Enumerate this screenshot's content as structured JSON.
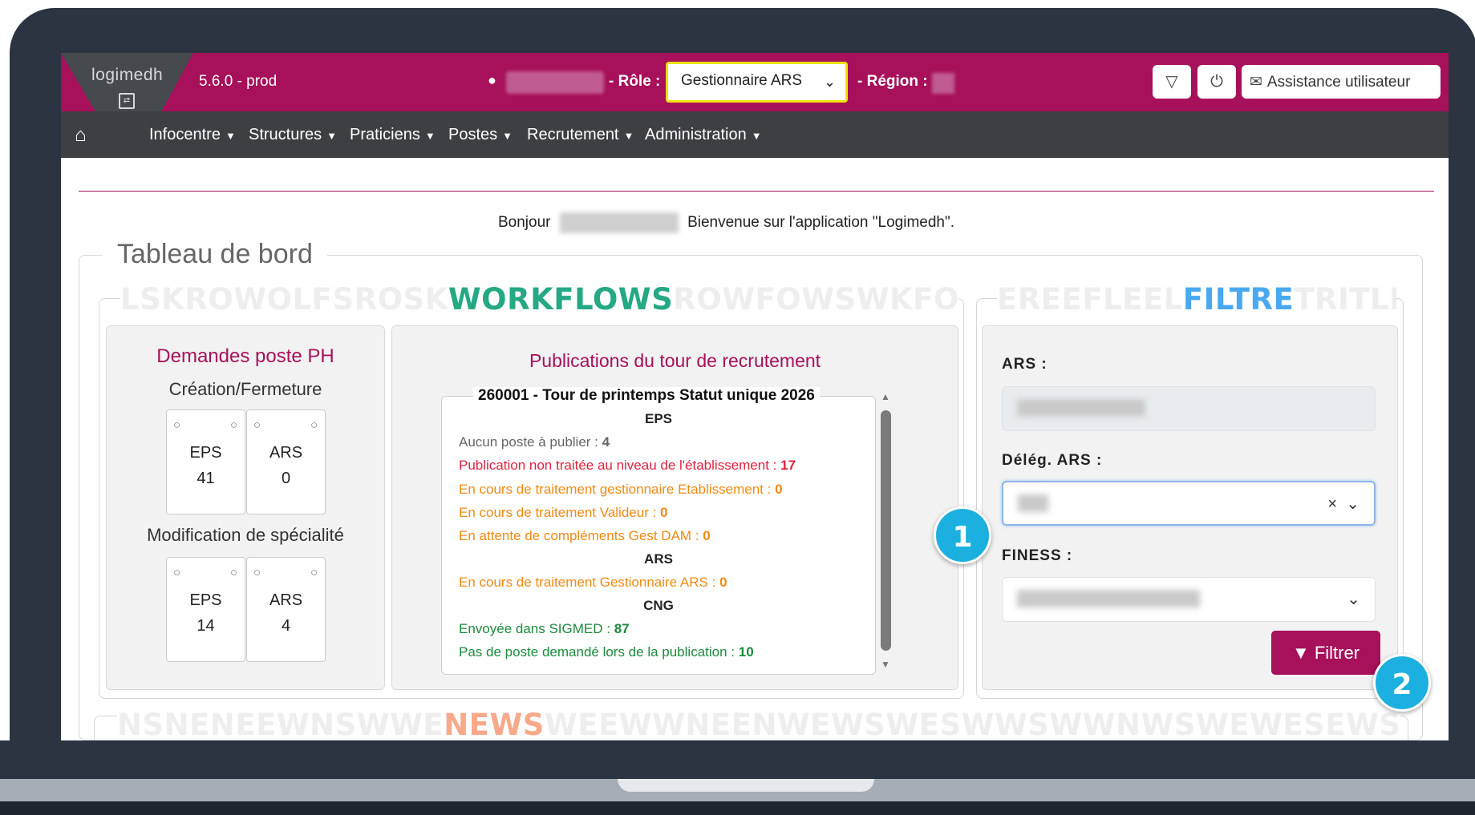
{
  "header": {
    "logo_text": "logimedh",
    "version": "5.6.0 - prod",
    "role_label": "- Rôle :",
    "role_value": "Gestionnaire ARS",
    "region_label": "- Région :",
    "assist_label": "Assistance utilisateur"
  },
  "nav": {
    "items": [
      "Infocentre",
      "Structures",
      "Praticiens",
      "Postes",
      "Recrutement",
      "Administration"
    ]
  },
  "welcome": {
    "greeting": "Bonjour",
    "message": "Bienvenue sur l'application \"Logimedh\"."
  },
  "dashboard": {
    "title": "Tableau de bord",
    "workflows_band": {
      "pre": "LSKROWOLFSROSK",
      "word": "WORKFLOWS",
      "post": "ROWFOWSWKFOOLO",
      "color": "#25a884"
    },
    "filtre_band": {
      "pre": "EREEFLEEL",
      "word": "FILTRE",
      "post": "TRITLL",
      "color": "#49a9f0"
    },
    "news_band": {
      "pre": "NSNENEEWNSWWE",
      "word": "NEWS",
      "post": "WEEWWNEENWEWSWESWWSWWNWSWEWESEWSWWNENE",
      "color": "#f7a98a"
    }
  },
  "demandes": {
    "title": "Demandes poste PH",
    "section1": "Création/Fermeture",
    "cards1": [
      {
        "label": "EPS",
        "value": "41"
      },
      {
        "label": "ARS",
        "value": "0"
      }
    ],
    "section2": "Modification de spécialité",
    "cards2": [
      {
        "label": "EPS",
        "value": "14"
      },
      {
        "label": "ARS",
        "value": "4"
      }
    ]
  },
  "publications": {
    "title": "Publications du tour de recrutement",
    "tour": "260001 - Tour de printemps Statut unique 2026",
    "eps_header": "EPS",
    "ars_header": "ARS",
    "cng_header": "CNG",
    "lines": [
      {
        "text": "Aucun poste à publier :",
        "value": "4"
      },
      {
        "text": "Publication non traitée au niveau de l'établissement :",
        "value": "17"
      },
      {
        "text": "En cours de traitement gestionnaire Etablissement :",
        "value": "0"
      },
      {
        "text": "En cours de traitement Valideur :",
        "value": "0"
      },
      {
        "text": "En attente de compléments Gest DAM :",
        "value": "0"
      },
      {
        "text": "En cours de traitement Gestionnaire ARS :",
        "value": "0"
      },
      {
        "text": "Envoyée dans SIGMED :",
        "value": "87"
      },
      {
        "text": "Pas de poste demandé lors de la publication :",
        "value": "10"
      }
    ]
  },
  "filter": {
    "ars_label": "ARS :",
    "deleg_label": "Délég. ARS :",
    "finess_label": "FINESS :",
    "button_label": "Filtrer"
  },
  "badges": [
    "1",
    "2"
  ],
  "colors": {
    "brand": "#a7105a",
    "nav": "#3d3f42",
    "badge": "#1cb0e0"
  }
}
